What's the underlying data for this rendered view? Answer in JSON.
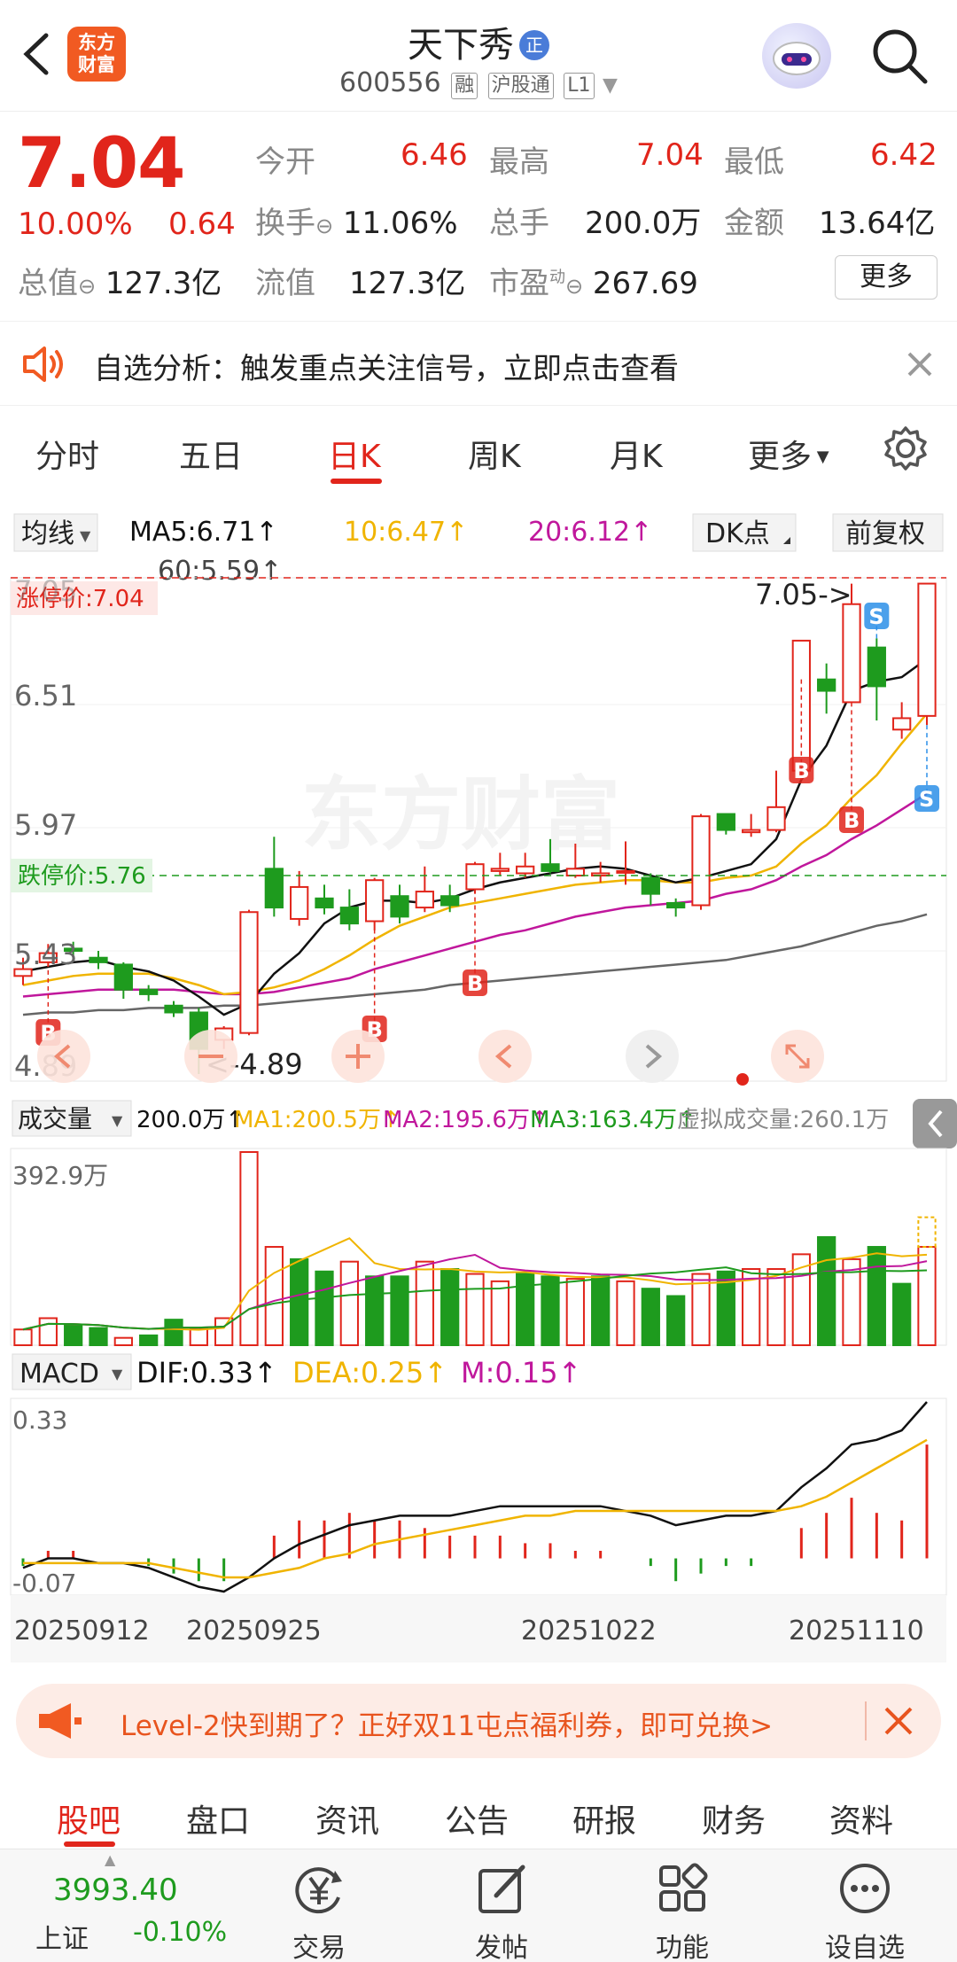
{
  "header": {
    "logo_text_1": "东方",
    "logo_text_2": "财富",
    "stock_name": "天下秀",
    "zheng_badge": "正",
    "code": "600556",
    "tags": [
      "融",
      "沪股通",
      "L1"
    ]
  },
  "quote": {
    "price": "7.04",
    "change_pct": "10.00%",
    "change": "0.64",
    "total_value_label": "总值",
    "total_value": "127.3亿",
    "open_label": "今开",
    "open": "6.46",
    "high_label": "最高",
    "high": "7.04",
    "low_label": "最低",
    "low": "6.42",
    "turnover_label": "换手",
    "turnover": "11.06%",
    "volume_label": "总手",
    "volume": "200.0万",
    "amount_label": "金额",
    "amount": "13.64亿",
    "float_label": "流值",
    "float_value": "127.3亿",
    "pe_label": "市盈",
    "pe_sup": "动",
    "pe": "267.69",
    "more_label": "更多"
  },
  "notice": {
    "text": "自选分析：触发重点关注信号，立即点击查看"
  },
  "tabs": [
    "分时",
    "五日",
    "日K",
    "周K",
    "月K",
    "更多"
  ],
  "active_tab": "日K",
  "kline": {
    "ma_selector": "均线",
    "ma5": "MA5:6.71↑",
    "ma10": "10:6.47↑",
    "ma20": "20:6.12↑",
    "ma60": "60:5.59↑",
    "dk_label": "DK点",
    "fq_label": "前复权",
    "limit_up_label": "涨停价:7.04",
    "limit_down_label": "跌停价:5.76",
    "axis_prices": [
      "7.05",
      "6.51",
      "5.97",
      "5.43",
      "4.89"
    ],
    "high_marker": "7.05->",
    "low_marker": "<-4.89",
    "watermark": "东方财富",
    "signals": [
      "B",
      "B",
      "B",
      "B",
      "B",
      "S",
      "S"
    ]
  },
  "volume": {
    "selector": "成交量",
    "value": "200.0万↑",
    "ma1": "MA1:200.5万↑",
    "ma2": "MA2:195.6万↑",
    "ma3": "MA3:163.4万↑",
    "virtual": "虚拟成交量:260.1万",
    "axis_max": "392.9万"
  },
  "macd": {
    "selector": "MACD",
    "dif": "DIF:0.33↑",
    "dea": "DEA:0.25↑",
    "m": "M:0.15↑",
    "axis_top": "0.33",
    "axis_bottom": "-0.07"
  },
  "dates": [
    "20250912",
    "20250925",
    "20251022",
    "20251110"
  ],
  "chart_data": {
    "type": "candlestick",
    "title": "",
    "ylim": [
      4.89,
      7.05
    ],
    "candles": [
      {
        "o": 5.32,
        "c": 5.35,
        "h": 5.4,
        "l": 5.28
      },
      {
        "o": 5.38,
        "c": 5.42,
        "h": 5.46,
        "l": 5.36
      },
      {
        "o": 5.44,
        "c": 5.43,
        "h": 5.47,
        "l": 5.4
      },
      {
        "o": 5.4,
        "c": 5.38,
        "h": 5.43,
        "l": 5.35
      },
      {
        "o": 5.37,
        "c": 5.26,
        "h": 5.38,
        "l": 5.22
      },
      {
        "o": 5.26,
        "c": 5.24,
        "h": 5.28,
        "l": 5.21
      },
      {
        "o": 5.19,
        "c": 5.16,
        "h": 5.21,
        "l": 5.14
      },
      {
        "o": 5.16,
        "c": 5.0,
        "h": 5.18,
        "l": 4.89
      },
      {
        "o": 5.04,
        "c": 5.09,
        "h": 5.1,
        "l": 5.0
      },
      {
        "o": 5.07,
        "c": 5.6,
        "h": 5.61,
        "l": 5.06
      },
      {
        "o": 5.79,
        "c": 5.62,
        "h": 5.93,
        "l": 5.58
      },
      {
        "o": 5.57,
        "c": 5.71,
        "h": 5.78,
        "l": 5.54
      },
      {
        "o": 5.66,
        "c": 5.62,
        "h": 5.72,
        "l": 5.59
      },
      {
        "o": 5.62,
        "c": 5.55,
        "h": 5.7,
        "l": 5.52
      },
      {
        "o": 5.56,
        "c": 5.74,
        "h": 5.75,
        "l": 5.52
      },
      {
        "o": 5.67,
        "c": 5.58,
        "h": 5.72,
        "l": 5.55
      },
      {
        "o": 5.62,
        "c": 5.69,
        "h": 5.8,
        "l": 5.6
      },
      {
        "o": 5.67,
        "c": 5.63,
        "h": 5.72,
        "l": 5.6
      },
      {
        "o": 5.7,
        "c": 5.81,
        "h": 5.82,
        "l": 5.68
      },
      {
        "o": 5.78,
        "c": 5.79,
        "h": 5.86,
        "l": 5.76
      },
      {
        "o": 5.77,
        "c": 5.8,
        "h": 5.86,
        "l": 5.75
      },
      {
        "o": 5.81,
        "c": 5.78,
        "h": 5.92,
        "l": 5.77
      },
      {
        "o": 5.76,
        "c": 5.79,
        "h": 5.9,
        "l": 5.75
      },
      {
        "o": 5.76,
        "c": 5.77,
        "h": 5.82,
        "l": 5.73
      },
      {
        "o": 5.78,
        "c": 5.78,
        "h": 5.91,
        "l": 5.72
      },
      {
        "o": 5.75,
        "c": 5.68,
        "h": 5.77,
        "l": 5.63
      },
      {
        "o": 5.64,
        "c": 5.62,
        "h": 5.66,
        "l": 5.58
      },
      {
        "o": 5.63,
        "c": 6.02,
        "h": 6.03,
        "l": 5.61
      },
      {
        "o": 6.03,
        "c": 5.96,
        "h": 6.03,
        "l": 5.94
      },
      {
        "o": 5.95,
        "c": 5.96,
        "h": 6.03,
        "l": 5.93
      },
      {
        "o": 5.96,
        "c": 6.06,
        "h": 6.22,
        "l": 5.95
      },
      {
        "o": 6.22,
        "c": 6.79,
        "h": 6.79,
        "l": 6.18
      },
      {
        "o": 6.62,
        "c": 6.57,
        "h": 6.69,
        "l": 6.47
      },
      {
        "o": 6.52,
        "c": 6.95,
        "h": 7.04,
        "l": 6.52
      },
      {
        "o": 6.76,
        "c": 6.59,
        "h": 6.8,
        "l": 6.44
      },
      {
        "o": 6.4,
        "c": 6.45,
        "h": 6.52,
        "l": 6.36
      },
      {
        "o": 6.46,
        "c": 7.04,
        "h": 7.04,
        "l": 6.42
      }
    ],
    "ma5": [
      5.34,
      5.36,
      5.38,
      5.39,
      5.36,
      5.34,
      5.3,
      5.23,
      5.15,
      5.2,
      5.33,
      5.42,
      5.55,
      5.62,
      5.65,
      5.65,
      5.64,
      5.66,
      5.7,
      5.73,
      5.75,
      5.77,
      5.79,
      5.8,
      5.79,
      5.76,
      5.73,
      5.75,
      5.78,
      5.81,
      5.92,
      6.18,
      6.33,
      6.57,
      6.61,
      6.63,
      6.71
    ],
    "ma10": [
      5.28,
      5.3,
      5.32,
      5.33,
      5.33,
      5.33,
      5.31,
      5.28,
      5.24,
      5.25,
      5.27,
      5.3,
      5.35,
      5.41,
      5.48,
      5.54,
      5.58,
      5.62,
      5.64,
      5.66,
      5.68,
      5.7,
      5.72,
      5.73,
      5.74,
      5.74,
      5.73,
      5.73,
      5.75,
      5.76,
      5.8,
      5.9,
      5.98,
      6.1,
      6.2,
      6.34,
      6.47
    ],
    "ma20": [
      5.23,
      5.24,
      5.25,
      5.26,
      5.26,
      5.26,
      5.26,
      5.25,
      5.24,
      5.24,
      5.25,
      5.27,
      5.29,
      5.31,
      5.35,
      5.38,
      5.41,
      5.44,
      5.47,
      5.5,
      5.52,
      5.55,
      5.58,
      5.6,
      5.62,
      5.63,
      5.64,
      5.65,
      5.68,
      5.7,
      5.74,
      5.8,
      5.85,
      5.92,
      5.98,
      6.05,
      6.12
    ],
    "ma60": [
      5.15,
      5.16,
      5.16,
      5.17,
      5.17,
      5.18,
      5.18,
      5.18,
      5.19,
      5.19,
      5.2,
      5.21,
      5.22,
      5.23,
      5.24,
      5.25,
      5.26,
      5.28,
      5.29,
      5.3,
      5.31,
      5.32,
      5.33,
      5.34,
      5.35,
      5.36,
      5.37,
      5.38,
      5.39,
      5.41,
      5.43,
      5.45,
      5.48,
      5.51,
      5.54,
      5.56,
      5.59
    ],
    "volume_wan": [
      32,
      55,
      42,
      35,
      15,
      20,
      52,
      35,
      55,
      392.9,
      200,
      175,
      150,
      170,
      140,
      140,
      170,
      155,
      145,
      130,
      145,
      140,
      135,
      140,
      130,
      115,
      100,
      145,
      150,
      155,
      155,
      185,
      220,
      175,
      200,
      125,
      200
    ],
    "volume_up": [
      true,
      true,
      false,
      false,
      true,
      false,
      false,
      true,
      true,
      true,
      true,
      false,
      false,
      true,
      false,
      false,
      true,
      false,
      true,
      true,
      false,
      false,
      true,
      false,
      true,
      false,
      false,
      true,
      false,
      true,
      true,
      true,
      false,
      true,
      false,
      false,
      true
    ],
    "macd_dif": [
      -0.02,
      0.0,
      0.0,
      -0.01,
      -0.01,
      -0.02,
      -0.04,
      -0.06,
      -0.07,
      -0.04,
      0.0,
      0.03,
      0.05,
      0.07,
      0.08,
      0.09,
      0.09,
      0.09,
      0.1,
      0.11,
      0.11,
      0.11,
      0.11,
      0.11,
      0.1,
      0.09,
      0.07,
      0.08,
      0.09,
      0.09,
      0.1,
      0.15,
      0.19,
      0.24,
      0.25,
      0.27,
      0.33
    ],
    "macd_dea": [
      -0.01,
      -0.01,
      -0.01,
      -0.01,
      -0.01,
      -0.01,
      -0.02,
      -0.03,
      -0.04,
      -0.04,
      -0.03,
      -0.02,
      0.0,
      0.01,
      0.03,
      0.04,
      0.05,
      0.06,
      0.07,
      0.08,
      0.09,
      0.09,
      0.1,
      0.1,
      0.1,
      0.1,
      0.1,
      0.1,
      0.1,
      0.1,
      0.1,
      0.11,
      0.13,
      0.16,
      0.19,
      0.22,
      0.25
    ],
    "macd_m": [
      -0.01,
      0.01,
      0.01,
      0.0,
      0.0,
      -0.01,
      -0.02,
      -0.03,
      -0.03,
      0.0,
      0.03,
      0.05,
      0.05,
      0.06,
      0.05,
      0.05,
      0.04,
      0.03,
      0.03,
      0.03,
      0.02,
      0.02,
      0.01,
      0.01,
      0.0,
      -0.01,
      -0.03,
      -0.02,
      -0.01,
      -0.01,
      0.0,
      0.04,
      0.06,
      0.08,
      0.06,
      0.05,
      0.15
    ],
    "colors": {
      "up": "#e1251b",
      "down": "#1e9b1e",
      "ma5": "#111111",
      "ma10": "#f0b400",
      "ma20": "#c0179c",
      "ma60": "#666666"
    }
  },
  "promo": {
    "text": "Level-2快到期了？正好双11屯点福利券，即可兑换>"
  },
  "bottom_tabs": [
    "股吧",
    "盘口",
    "资讯",
    "公告",
    "研报",
    "财务",
    "资料"
  ],
  "bottom_nav": {
    "index_value": "3993.40",
    "index_name": "上证",
    "index_change": "-0.10%",
    "items": [
      "交易",
      "发帖",
      "功能",
      "设自选"
    ]
  }
}
